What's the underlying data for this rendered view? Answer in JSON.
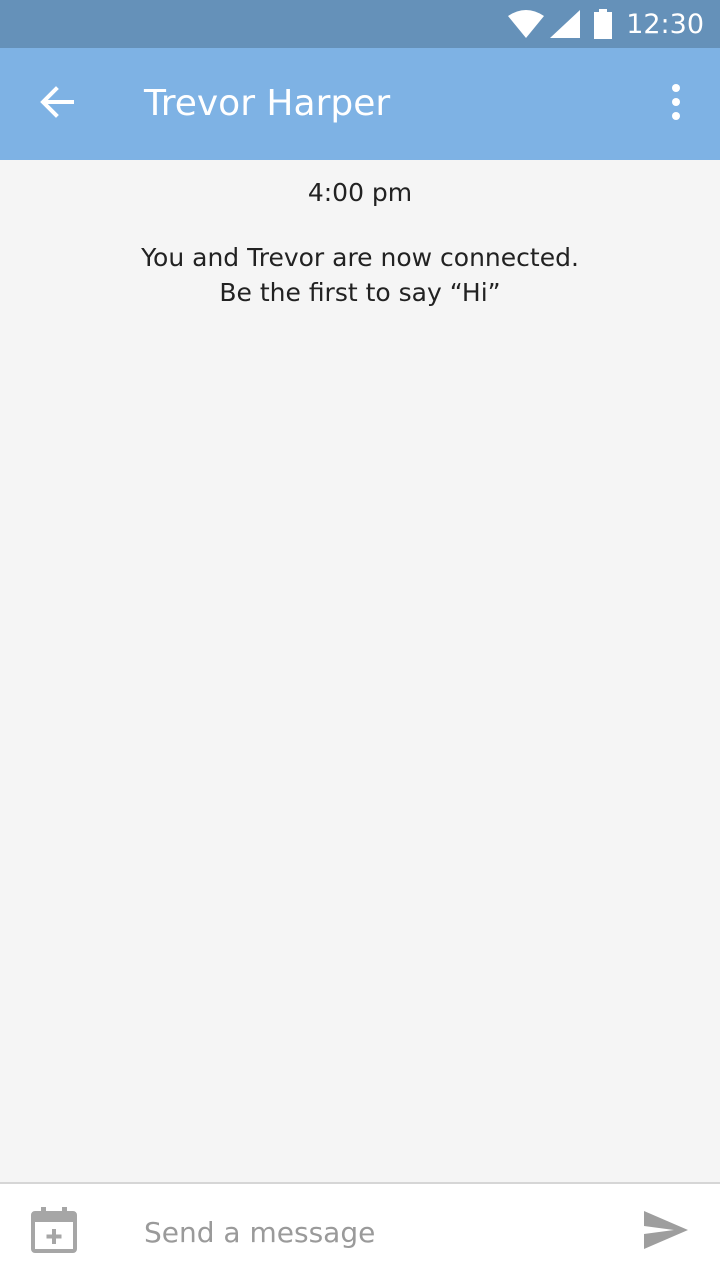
{
  "status_bar": {
    "time": "12:30",
    "icons": [
      "wifi-icon",
      "cell-signal-icon",
      "battery-icon"
    ]
  },
  "app_bar": {
    "title": "Trevor Harper",
    "back_icon": "arrow-back-icon",
    "menu_icon": "more-vert-icon"
  },
  "chat": {
    "timestamp": "4:00 pm",
    "connected_line1": "You and Trevor are now connected.",
    "connected_line2": "Be the first to say “Hi”"
  },
  "composer": {
    "calendar_icon": "calendar-add-icon",
    "placeholder": "Send a message",
    "send_icon": "send-icon"
  },
  "colors": {
    "status_bar": "#6591b9",
    "app_bar": "#7eb2e4",
    "background": "#f5f5f5"
  }
}
